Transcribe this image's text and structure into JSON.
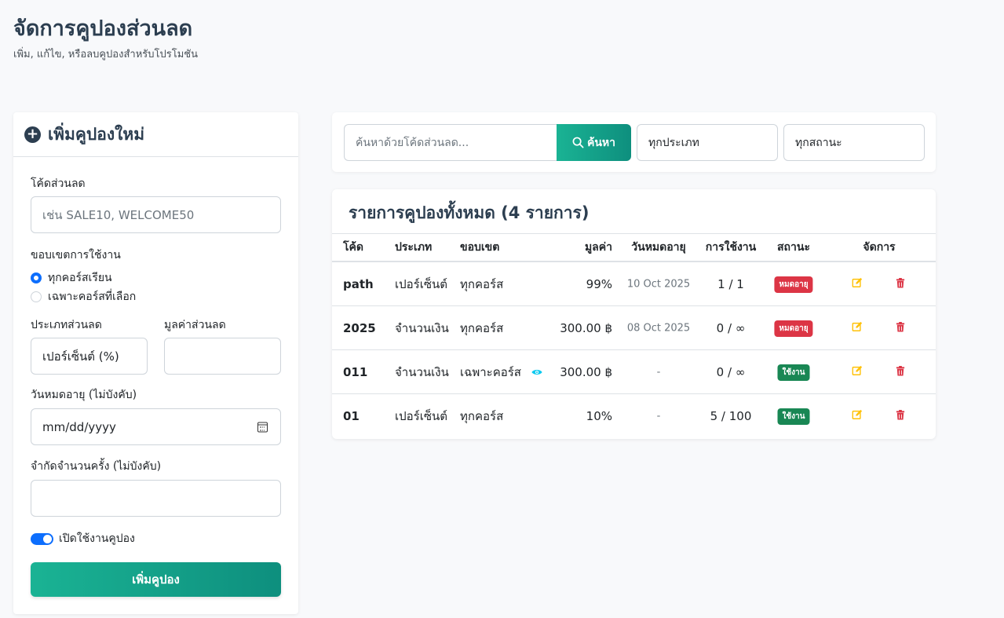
{
  "header": {
    "title": "จัดการคูปองส่วนลด",
    "subtitle": "เพิ่ม, แก้ไข, หรือลบคูปองสำหรับโปรโมชัน"
  },
  "add_form": {
    "title": "เพิ่มคูปองใหม่",
    "code_label": "โค้ดส่วนลด",
    "code_placeholder": "เช่น SALE10, WELCOME50",
    "scope_label": "ขอบเขตการใช้งาน",
    "scope_options": [
      "ทุกคอร์สเรียน",
      "เฉพาะคอร์สที่เลือก"
    ],
    "scope_selected": 0,
    "type_label": "ประเภทส่วนลด",
    "type_value": "เปอร์เซ็นต์ (%)",
    "value_label": "มูลค่าส่วนลด",
    "value_value": "",
    "expiry_label": "วันหมดอายุ (ไม่บังคับ)",
    "expiry_placeholder": "mm/dd/yyyy",
    "limit_label": "จำกัดจำนวนครั้ง (ไม่บังคับ)",
    "limit_value": "",
    "enable_label": "เปิดใช้งานคูปอง",
    "submit_label": "เพิ่มคูปอง"
  },
  "search": {
    "placeholder": "ค้นหาด้วยโค้ดส่วนลด...",
    "button_label": "ค้นหา",
    "type_filter": "ทุกประเภท",
    "status_filter": "ทุกสถานะ"
  },
  "table": {
    "title": "รายการคูปองทั้งหมด (4 รายการ)",
    "columns": [
      "โค้ด",
      "ประเภท",
      "ขอบเขต",
      "มูลค่า",
      "วันหมดอายุ",
      "การใช้งาน",
      "สถานะ",
      "จัดการ"
    ],
    "rows": [
      {
        "code": "path",
        "type": "เปอร์เซ็นต์",
        "scope": "ทุกคอร์ส",
        "value": "99%",
        "expiry": "10 Oct 2025",
        "usage": "1 / 1",
        "status": "หมดอายุ",
        "status_kind": "expired"
      },
      {
        "code": "2025",
        "type": "จำนวนเงิน",
        "scope": "ทุกคอร์ส",
        "value": "300.00 ฿",
        "expiry": "08 Oct 2025",
        "usage": "0 / ∞",
        "status": "หมดอายุ",
        "status_kind": "expired"
      },
      {
        "code": "011",
        "type": "จำนวนเงิน",
        "scope": "เฉพาะคอร์ส",
        "value": "300.00 ฿",
        "expiry": "-",
        "usage": "0 / ∞",
        "status": "ใช้งาน",
        "status_kind": "active"
      },
      {
        "code": "01",
        "type": "เปอร์เซ็นต์",
        "scope": "ทุกคอร์ส",
        "value": "10%",
        "expiry": "-",
        "usage": "5 / 100",
        "status": "ใช้งาน",
        "status_kind": "active"
      }
    ]
  },
  "colors": {
    "accent": "#1ab394",
    "primary": "#0d6efd",
    "danger": "#dc3545",
    "success": "#198754",
    "edit_icon": "#ffc107"
  }
}
